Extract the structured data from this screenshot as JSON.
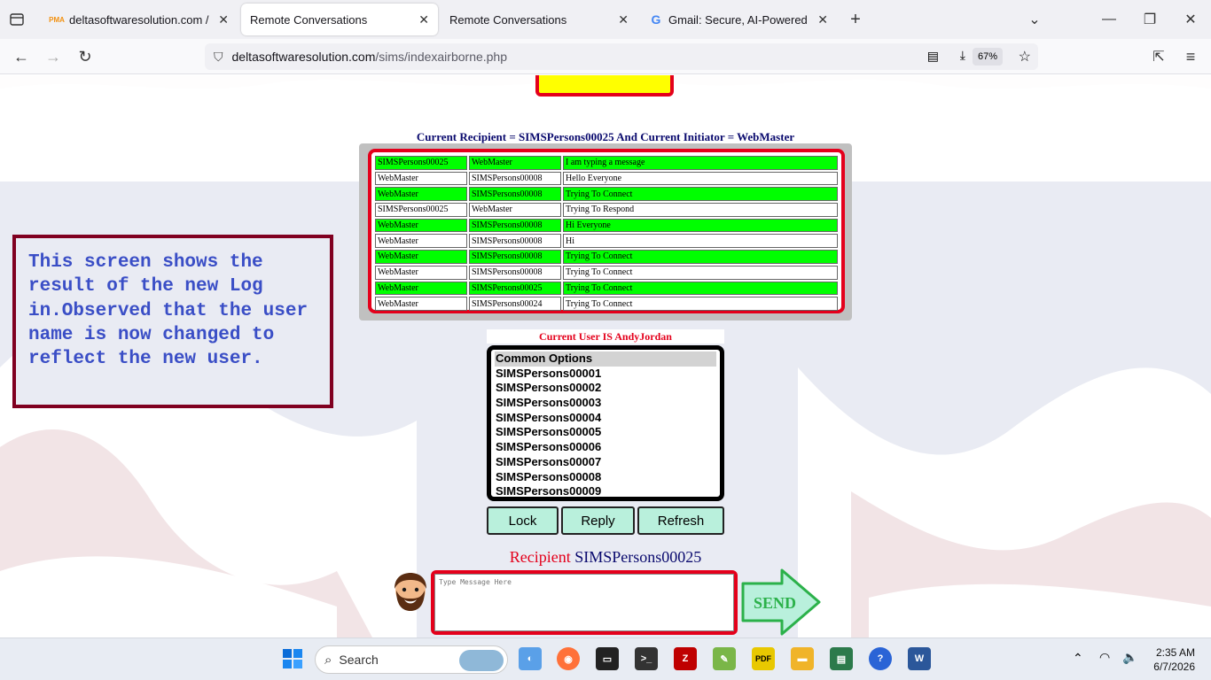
{
  "browser": {
    "tabs": [
      {
        "title": "deltasoftwaresolution.com / loc",
        "favicon": "PMA",
        "active": false
      },
      {
        "title": "Remote Conversations",
        "active": true
      },
      {
        "title": "Remote Conversations",
        "active": false
      },
      {
        "title": "Gmail: Secure, AI-Powered Emai",
        "favicon": "G",
        "active": false
      }
    ],
    "url_host": "deltasoftwaresolution.com",
    "url_path": "/sims/indexairborne.php",
    "zoom": "67%"
  },
  "conversation": {
    "title": "Current Recipient = SIMSPersons00025 And Current Initiator = WebMaster",
    "rows": [
      {
        "from": "SIMSPersons00025",
        "to": "WebMaster",
        "message": "I am typing a message",
        "style": "green"
      },
      {
        "from": "WebMaster",
        "to": "SIMSPersons00008",
        "message": "Hello Everyone",
        "style": "white"
      },
      {
        "from": "WebMaster",
        "to": "SIMSPersons00008",
        "message": "Trying To Connect",
        "style": "green"
      },
      {
        "from": "SIMSPersons00025",
        "to": "WebMaster",
        "message": "Trying To Respond",
        "style": "white"
      },
      {
        "from": "WebMaster",
        "to": "SIMSPersons00008",
        "message": "Hi Everyone",
        "style": "green"
      },
      {
        "from": "WebMaster",
        "to": "SIMSPersons00008",
        "message": "Hi",
        "style": "white"
      },
      {
        "from": "WebMaster",
        "to": "SIMSPersons00008",
        "message": "Trying To Connect",
        "style": "green"
      },
      {
        "from": "WebMaster",
        "to": "SIMSPersons00008",
        "message": "Trying To Connect",
        "style": "white"
      },
      {
        "from": "WebMaster",
        "to": "SIMSPersons00025",
        "message": "Trying To Connect",
        "style": "green"
      },
      {
        "from": "WebMaster",
        "to": "SIMSPersons00024",
        "message": "Trying To Connect",
        "style": "white"
      }
    ]
  },
  "current_user": "Current User IS AndyJordan",
  "options": {
    "selected": "Common Options",
    "items": [
      "Common Options",
      "SIMSPersons00001",
      "SIMSPersons00002",
      "SIMSPersons00003",
      "SIMSPersons00004",
      "SIMSPersons00005",
      "SIMSPersons00006",
      "SIMSPersons00007",
      "SIMSPersons00008",
      "SIMSPersons00009"
    ]
  },
  "buttons": {
    "lock": "Lock",
    "reply": "Reply",
    "refresh": "Refresh",
    "send": "SEND"
  },
  "recipient": {
    "label": "Recipient",
    "value": "SIMSPersons00025"
  },
  "message_input": {
    "placeholder": "Type Message Here",
    "value": ""
  },
  "annotation": "This screen shows the result of the new Log in.Observed that the user name is now changed to reflect the new user.",
  "taskbar": {
    "search_label": "Search",
    "time": "2:35 AM",
    "date": "6/7/2026"
  },
  "colors": {
    "accent_red": "#e4001b",
    "row_green": "#00ff00",
    "button_mint": "#b9f0dc",
    "title_navy": "#0a0a6e"
  }
}
